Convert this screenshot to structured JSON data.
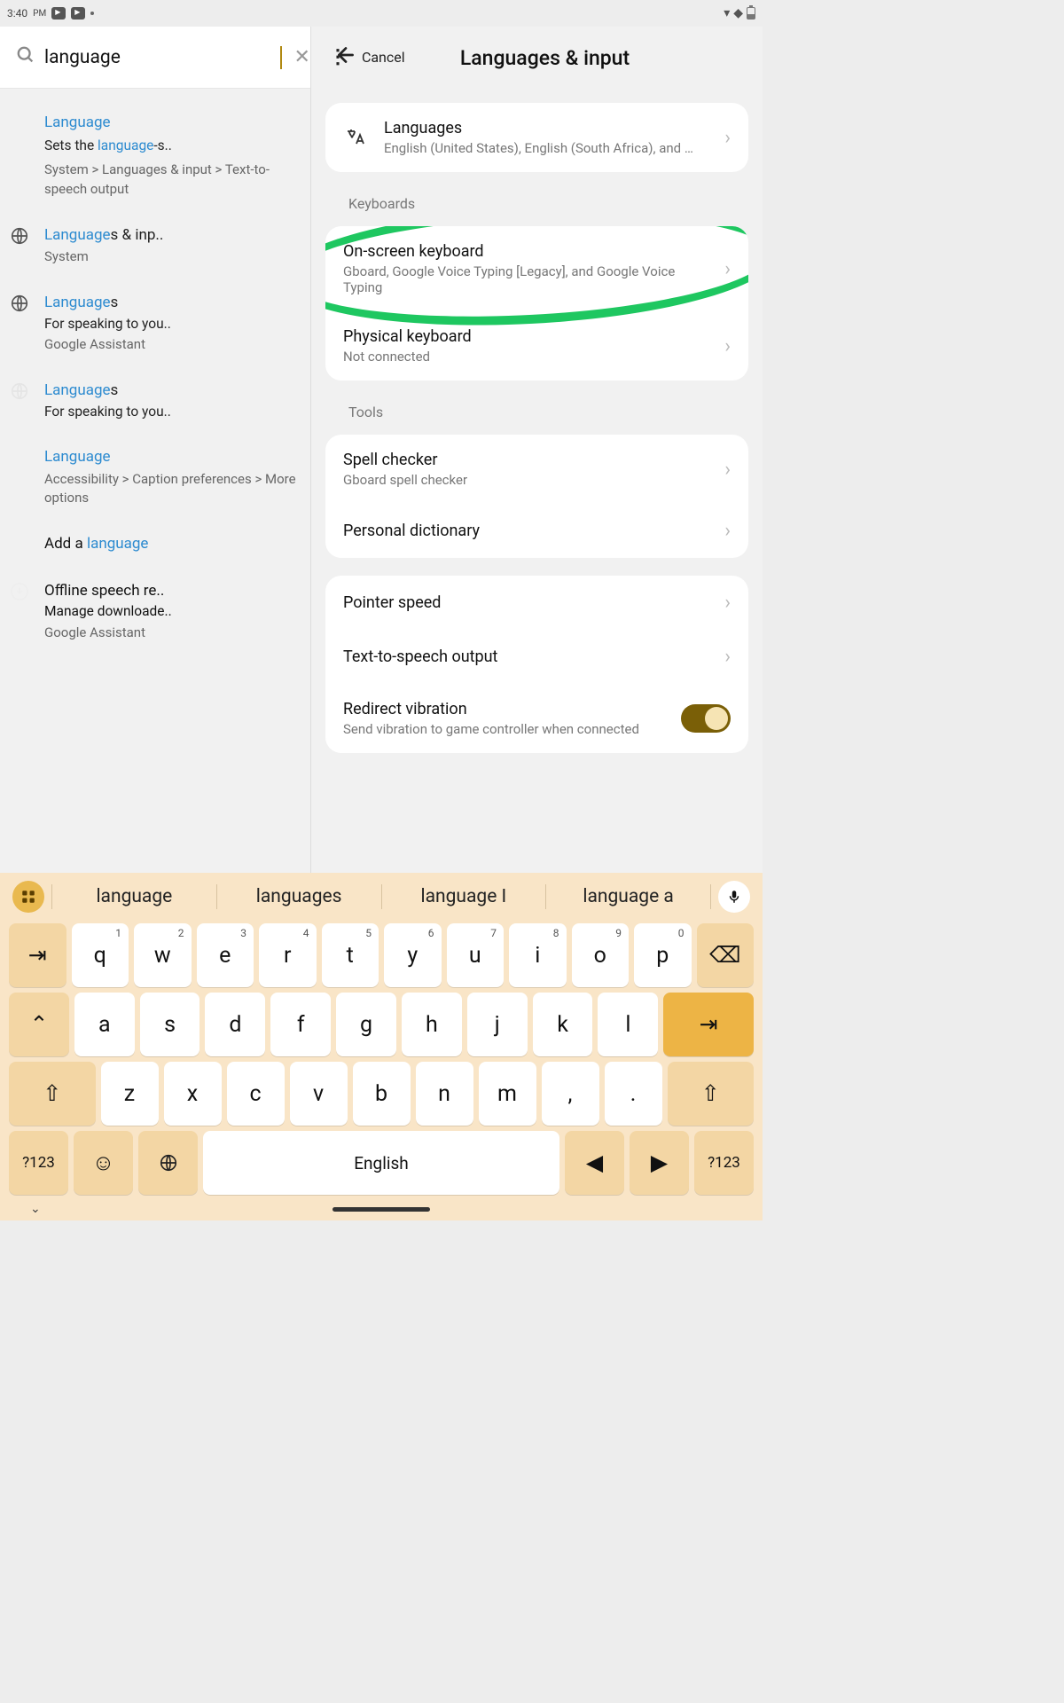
{
  "statusbar": {
    "time": "3:40",
    "ampm": "PM"
  },
  "search": {
    "query": "language",
    "cancel": "Cancel"
  },
  "results": [
    {
      "icon": "",
      "title_hl": "Language",
      "title_rest": "",
      "sub_pre": "Sets the ",
      "sub_hl": "language",
      "sub_post": "-s..",
      "path": "System > Languages & input > Text-to-speech output"
    },
    {
      "icon": "globe",
      "title_hl": "Language",
      "title_rest": "s & inp..",
      "sub_pre": "",
      "sub_hl": "",
      "sub_post": "",
      "path": "System"
    },
    {
      "icon": "globe",
      "title_hl": "Language",
      "title_rest": "s",
      "sub_pre": "For speaking to you..",
      "sub_hl": "",
      "sub_post": "",
      "path": "Google Assistant"
    },
    {
      "icon": "globe-dim",
      "title_hl": "Language",
      "title_rest": "s",
      "sub_pre": "For speaking to you..",
      "sub_hl": "",
      "sub_post": "",
      "path": ""
    },
    {
      "icon": "",
      "title_hl": "Language",
      "title_rest": "",
      "sub_pre": "",
      "sub_hl": "",
      "sub_post": "",
      "path": "Accessibility > Caption preferences > More options"
    },
    {
      "icon": "",
      "title_hl": "",
      "title_rest": "",
      "sub_pre": "Add a ",
      "sub_hl": "language",
      "sub_post": "",
      "path": ""
    },
    {
      "icon": "download-dim",
      "title_hl": "",
      "title_rest": "",
      "sub_pre": "",
      "sub_hl": "",
      "sub_post": "",
      "plain_title": "Offline speech re..",
      "plain_sub": "Manage downloade..",
      "path": "Google Assistant"
    }
  ],
  "right": {
    "header": "Languages & input",
    "langs_title": "Languages",
    "langs_sub": "English (United States), English (South Africa), and …",
    "keyboards_label": "Keyboards",
    "onscreen_title": "On-screen keyboard",
    "onscreen_sub": "Gboard, Google Voice Typing [Legacy], and Google Voice Typing",
    "physical_title": "Physical keyboard",
    "physical_sub": "Not connected",
    "tools_label": "Tools",
    "spell_title": "Spell checker",
    "spell_sub": "Gboard spell checker",
    "dict_title": "Personal dictionary",
    "pointer_title": "Pointer speed",
    "tts_title": "Text-to-speech output",
    "redirect_title": "Redirect vibration",
    "redirect_sub": "Send vibration to game controller when connected"
  },
  "kbd": {
    "suggestions": [
      "language",
      "languages",
      "language I",
      "language a"
    ],
    "row1": [
      {
        "k": "q",
        "s": "1"
      },
      {
        "k": "w",
        "s": "2"
      },
      {
        "k": "e",
        "s": "3"
      },
      {
        "k": "r",
        "s": "4"
      },
      {
        "k": "t",
        "s": "5"
      },
      {
        "k": "y",
        "s": "6"
      },
      {
        "k": "u",
        "s": "7"
      },
      {
        "k": "i",
        "s": "8"
      },
      {
        "k": "o",
        "s": "9"
      },
      {
        "k": "p",
        "s": "0"
      }
    ],
    "row2": [
      "a",
      "s",
      "d",
      "f",
      "g",
      "h",
      "j",
      "k",
      "l"
    ],
    "row3": [
      "z",
      "x",
      "c",
      "v",
      "b",
      "n",
      "m",
      ",",
      "."
    ],
    "space": "English",
    "sym": "?123"
  }
}
